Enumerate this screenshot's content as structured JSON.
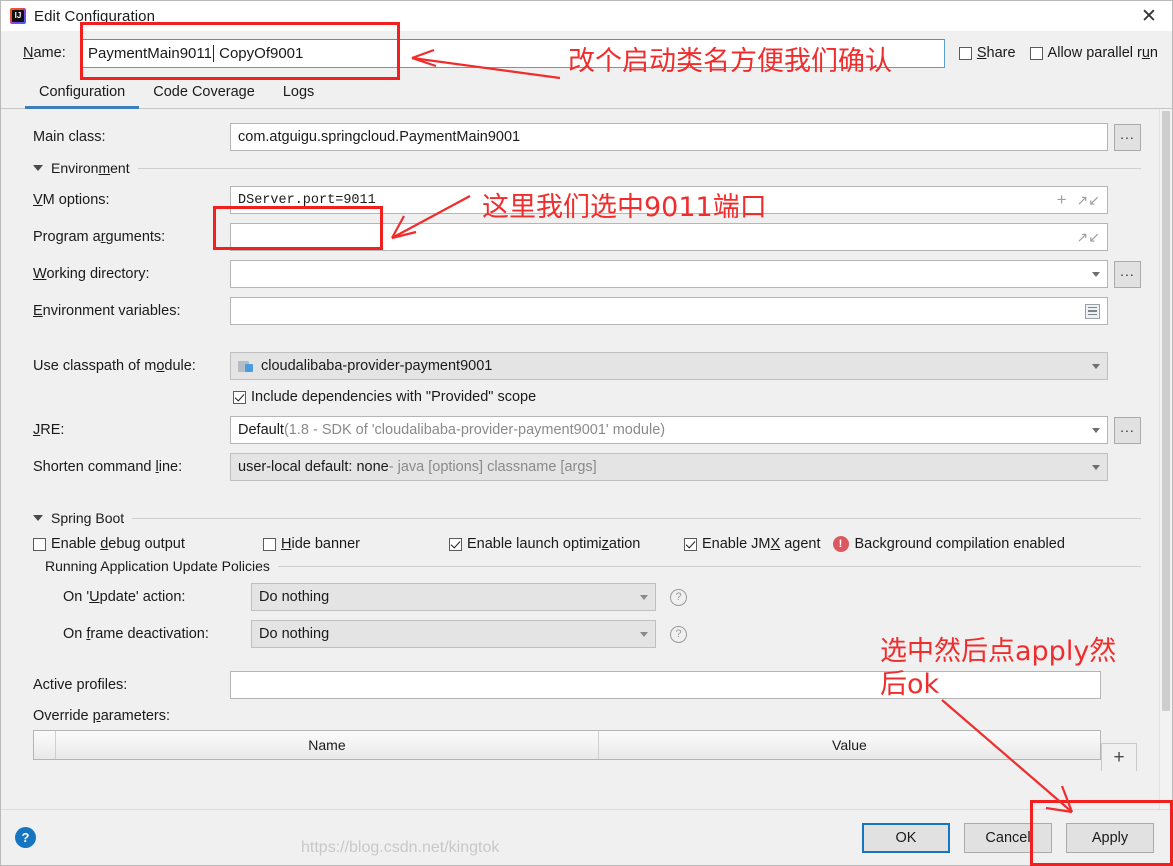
{
  "window": {
    "title": "Edit Configuration",
    "logo_icon": "intellij-idea-logo",
    "close_icon": "close-icon"
  },
  "name_row": {
    "label": "Name:",
    "value_before_caret": "PaymentMain9011",
    "value_after_caret": " CopyOf9001",
    "share": {
      "label": "Share",
      "checked": false
    },
    "allow_parallel_run": {
      "label": "Allow parallel run",
      "checked": false
    }
  },
  "tabs": [
    {
      "label": "Configuration",
      "active": true
    },
    {
      "label": "Code Coverage",
      "active": false
    },
    {
      "label": "Logs",
      "active": false
    }
  ],
  "form": {
    "main_class": {
      "label": "Main class:",
      "value": "com.atguigu.springcloud.PaymentMain9001",
      "browse": "..."
    },
    "environment_section": {
      "label": "Environment"
    },
    "vm_options": {
      "label": "VM options:",
      "value": "DServer.port=9011",
      "icons": [
        "plus-icon",
        "expand-icon"
      ]
    },
    "program_arguments": {
      "label": "Program arguments:",
      "value": "",
      "icons": [
        "expand-icon"
      ]
    },
    "working_directory": {
      "label": "Working directory:",
      "value": "",
      "icons": [
        "chevron-down-icon"
      ],
      "browse": "..."
    },
    "environment_variables": {
      "label": "Environment variables:",
      "value": "",
      "icons": [
        "list-icon"
      ]
    },
    "use_classpath_of_module": {
      "label": "Use classpath of module:",
      "value": "cloudalibaba-provider-payment9001",
      "icons": [
        "chevron-down-icon"
      ]
    },
    "include_dependencies": {
      "label": "Include dependencies with \"Provided\" scope",
      "checked": true
    },
    "jre": {
      "label": "JRE:",
      "value_strong": "Default",
      "value_sub": " (1.8 - SDK of 'cloudalibaba-provider-payment9001' module)",
      "browse": "..."
    },
    "shorten_command_line": {
      "label": "Shorten command line:",
      "value_strong": "user-local default: none",
      "value_sub": " - java [options] classname [args]"
    }
  },
  "spring_boot": {
    "section_label": "Spring Boot",
    "checks": [
      {
        "label": "Enable debug output",
        "checked": false
      },
      {
        "label": "Hide banner",
        "checked": false
      },
      {
        "label": "Enable launch optimization",
        "checked": true
      },
      {
        "label": "Enable JMX agent",
        "checked": true
      }
    ],
    "background_compilation": {
      "icon": "warning-icon",
      "label": "Background compilation enabled"
    },
    "update_policies": {
      "group_label": "Running Application Update Policies",
      "rows": [
        {
          "label": "On 'Update' action:",
          "value": "Do nothing",
          "help": "?"
        },
        {
          "label": "On frame deactivation:",
          "value": "Do nothing",
          "help": "?"
        }
      ]
    },
    "active_profiles": {
      "label": "Active profiles:",
      "value": ""
    },
    "override_parameters": {
      "label": "Override parameters:",
      "columns": [
        "Name",
        "Value"
      ],
      "add_button": "+"
    }
  },
  "footer": {
    "help_icon": "?",
    "buttons": [
      {
        "label": "OK",
        "primary": true
      },
      {
        "label": "Cancel",
        "primary": false
      },
      {
        "label": "Apply",
        "primary": false
      }
    ],
    "watermark": "https://blog.csdn.net/kingtok"
  },
  "annotations": [
    {
      "id": "ann-name",
      "text": "改个启动类名方便我们确认"
    },
    {
      "id": "ann-vm",
      "text": "这里我们选中9011端口"
    },
    {
      "id": "ann-apply",
      "text": "选中然后点apply然\n后ok"
    }
  ]
}
